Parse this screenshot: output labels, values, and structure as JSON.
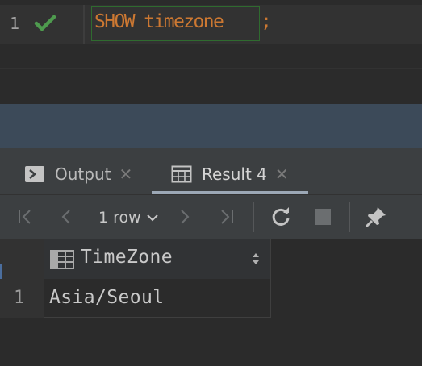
{
  "editor": {
    "line_number": "1",
    "status_icon": "checkmark-icon",
    "code_keyword": "SHOW timezone",
    "code_semicolon": ";"
  },
  "tabs": [
    {
      "label": "Output",
      "icon": "console-icon",
      "close": "✕"
    },
    {
      "label": "Result 4",
      "icon": "table-icon",
      "close": "✕",
      "active": true
    }
  ],
  "toolbar": {
    "rows_label": "1 row",
    "buttons": [
      "first-page-icon",
      "previous-page-icon",
      "next-page-icon",
      "last-page-icon",
      "refresh-icon",
      "stop-icon",
      "pin-icon"
    ]
  },
  "grid": {
    "columns": [
      "TimeZone"
    ],
    "rows": [
      {
        "row_number": "1",
        "values": [
          "Asia/Seoul"
        ]
      }
    ]
  },
  "colors": {
    "keyword": "#cc7832",
    "check": "#4e9a4e",
    "background": "#2b2b2b",
    "panel": "#3c3f41",
    "splitter": "#3c4a59"
  }
}
